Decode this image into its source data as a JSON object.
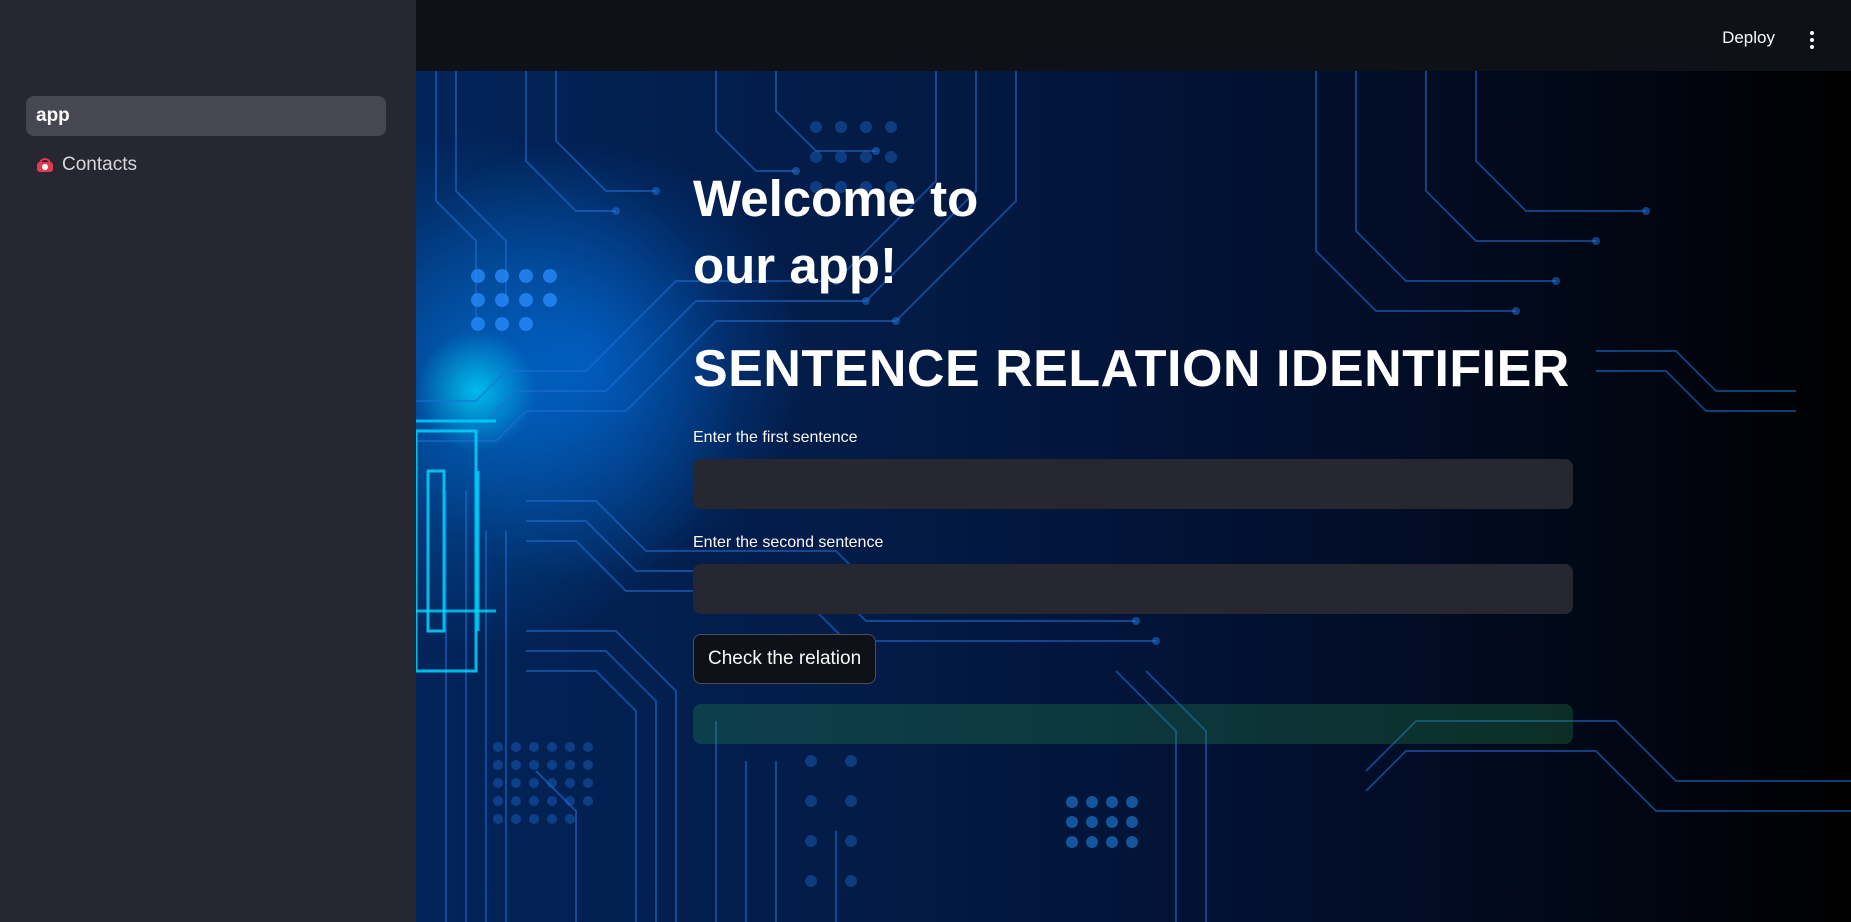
{
  "sidebar": {
    "items": [
      {
        "label": "app",
        "active": true
      },
      {
        "label": "Contacts",
        "icon": "telephone-icon",
        "active": false
      }
    ]
  },
  "header": {
    "deploy_label": "Deploy",
    "menu_icon": "vertical-dots-icon"
  },
  "main": {
    "welcome_line1": "Welcome to",
    "welcome_line2": "our app!",
    "title": "SENTENCE RELATION IDENTIFIER",
    "first_field": {
      "label": "Enter the first sentence",
      "value": ""
    },
    "second_field": {
      "label": "Enter the second sentence",
      "value": ""
    },
    "check_button_label": "Check the relation",
    "result_text": ""
  },
  "colors": {
    "sidebar_bg": "#262730",
    "header_bg": "#0e1117",
    "input_bg": "#262730",
    "result_bg": "#1d4d36",
    "accent_icon": "#e03a52"
  }
}
